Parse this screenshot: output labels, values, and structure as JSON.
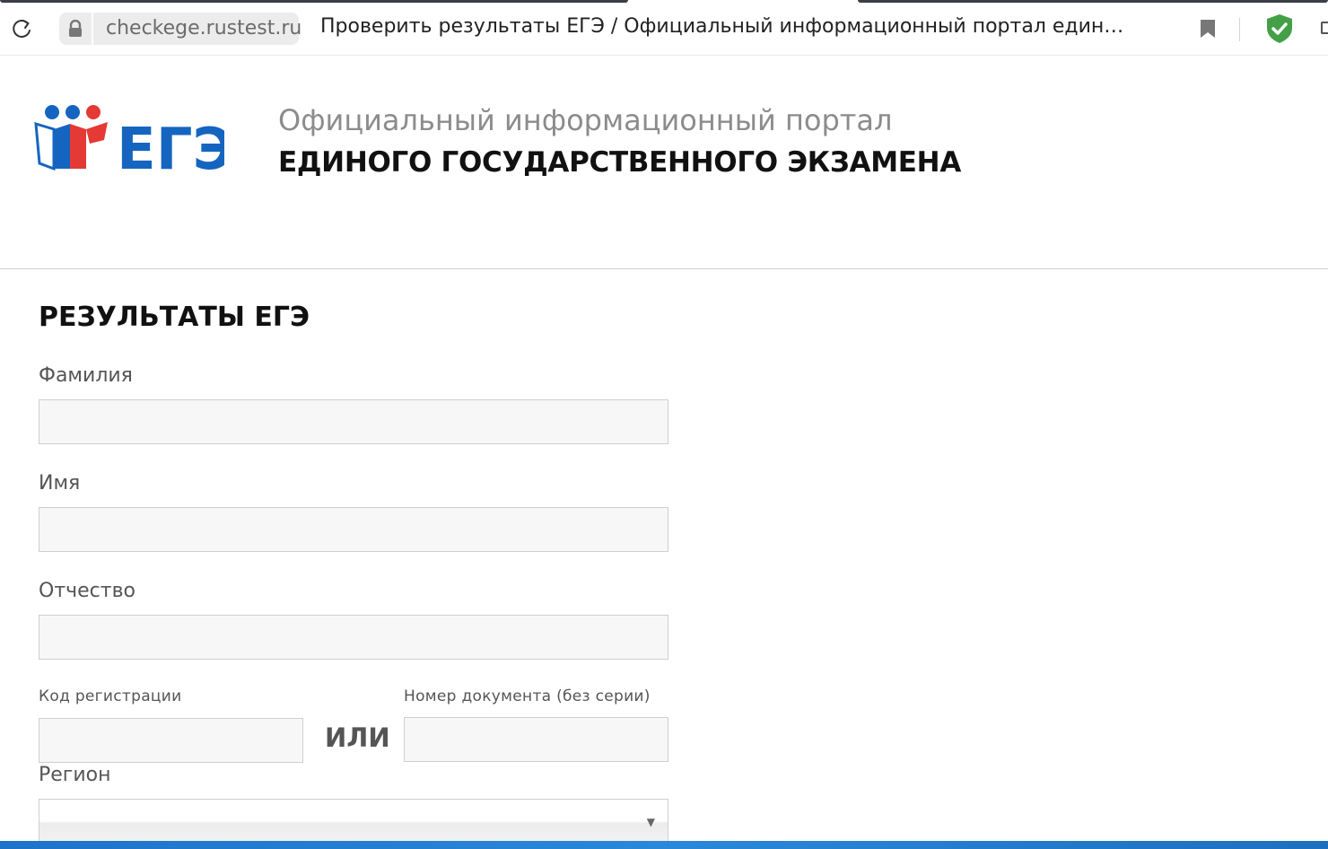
{
  "browser": {
    "url": "checkege.rustest.ru",
    "tab_title": "Проверить результаты ЕГЭ / Официальный информационный портал единого г..."
  },
  "site": {
    "logo_text": "ЕГЭ",
    "portal_line1": "Официальный информационный портал",
    "portal_line2": "ЕДИНОГО ГОСУДАРСТВЕННОГО ЭКЗАМЕНА"
  },
  "form": {
    "heading": "РЕЗУЛЬТАТЫ ЕГЭ",
    "surname_label": "Фамилия",
    "surname_value": "",
    "name_label": "Имя",
    "name_value": "",
    "patronymic_label": "Отчество",
    "patronymic_value": "",
    "reg_code_label": "Код регистрации",
    "reg_code_value": "",
    "or_label": "ИЛИ",
    "doc_number_label": "Номер документа (без серии)",
    "doc_number_value": "",
    "region_label": "Регион",
    "region_value": ""
  },
  "colors": {
    "logo_blue": "#1565c0",
    "logo_red": "#e53935",
    "shield_green": "#43a047",
    "bottom_strip": "#1e73c8"
  },
  "icons": [
    "reload-icon",
    "lock-icon",
    "bookmark-icon",
    "shield-check-icon",
    "dropdown-arrow-icon"
  ]
}
